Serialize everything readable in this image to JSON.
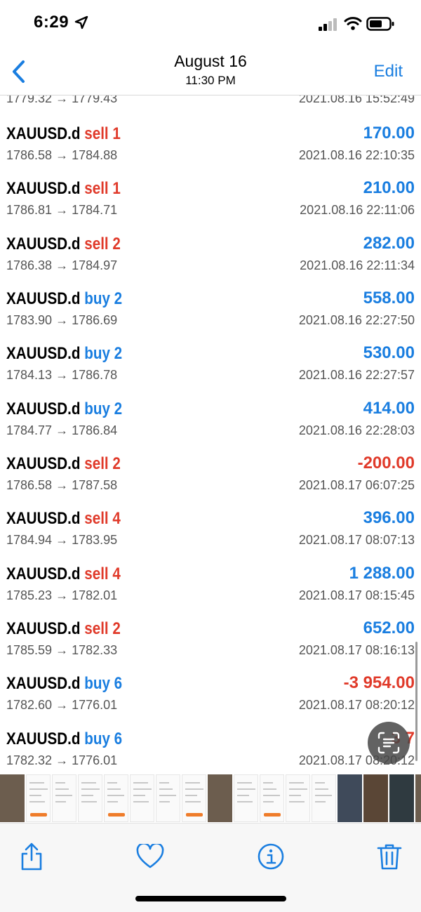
{
  "status_bar": {
    "time": "6:29"
  },
  "header": {
    "title": "August 16",
    "subtitle": "11:30 PM",
    "edit_label": "Edit"
  },
  "partial_row": {
    "prices": "1779.32 → 1779.43",
    "datetime": "2021.08.16 15:52:49"
  },
  "trades": [
    {
      "symbol": "XAUUSD.d",
      "action": "sell 1",
      "side": "sell",
      "profit": "170.00",
      "sign": "pos",
      "prices": "1786.58 → 1784.88",
      "datetime": "2021.08.16 22:10:35"
    },
    {
      "symbol": "XAUUSD.d",
      "action": "sell 1",
      "side": "sell",
      "profit": "210.00",
      "sign": "pos",
      "prices": "1786.81 → 1784.71",
      "datetime": "2021.08.16 22:11:06"
    },
    {
      "symbol": "XAUUSD.d",
      "action": "sell 2",
      "side": "sell",
      "profit": "282.00",
      "sign": "pos",
      "prices": "1786.38 → 1784.97",
      "datetime": "2021.08.16 22:11:34"
    },
    {
      "symbol": "XAUUSD.d",
      "action": "buy 2",
      "side": "buy",
      "profit": "558.00",
      "sign": "pos",
      "prices": "1783.90 → 1786.69",
      "datetime": "2021.08.16 22:27:50"
    },
    {
      "symbol": "XAUUSD.d",
      "action": "buy 2",
      "side": "buy",
      "profit": "530.00",
      "sign": "pos",
      "prices": "1784.13 → 1786.78",
      "datetime": "2021.08.16 22:27:57"
    },
    {
      "symbol": "XAUUSD.d",
      "action": "buy 2",
      "side": "buy",
      "profit": "414.00",
      "sign": "pos",
      "prices": "1784.77 → 1786.84",
      "datetime": "2021.08.16 22:28:03"
    },
    {
      "symbol": "XAUUSD.d",
      "action": "sell 2",
      "side": "sell",
      "profit": "-200.00",
      "sign": "neg",
      "prices": "1786.58 → 1787.58",
      "datetime": "2021.08.17 06:07:25"
    },
    {
      "symbol": "XAUUSD.d",
      "action": "sell 4",
      "side": "sell",
      "profit": "396.00",
      "sign": "pos",
      "prices": "1784.94 → 1783.95",
      "datetime": "2021.08.17 08:07:13"
    },
    {
      "symbol": "XAUUSD.d",
      "action": "sell 4",
      "side": "sell",
      "profit": "1 288.00",
      "sign": "pos",
      "prices": "1785.23 → 1782.01",
      "datetime": "2021.08.17 08:15:45"
    },
    {
      "symbol": "XAUUSD.d",
      "action": "sell 2",
      "side": "sell",
      "profit": "652.00",
      "sign": "pos",
      "prices": "1785.59 → 1782.33",
      "datetime": "2021.08.17 08:16:13"
    },
    {
      "symbol": "XAUUSD.d",
      "action": "buy 6",
      "side": "buy",
      "profit": "-3 954.00",
      "sign": "neg",
      "prices": "1782.60 → 1776.01",
      "datetime": "2021.08.17 08:20:12"
    },
    {
      "symbol": "XAUUSD.d",
      "action": "buy 6",
      "side": "buy",
      "profit": "-3 7",
      "sign": "neg",
      "prices": "1782.32 → 1776.01",
      "datetime": "2021.08.17 08:20:12"
    }
  ],
  "colors": {
    "accent": "#1a7ee0",
    "sell": "#e03a2a",
    "negative": "#e03a2a",
    "positive": "#1a7ee0"
  },
  "toolbar": {
    "icons": [
      "share-icon",
      "heart-icon",
      "info-icon",
      "trash-icon"
    ]
  }
}
